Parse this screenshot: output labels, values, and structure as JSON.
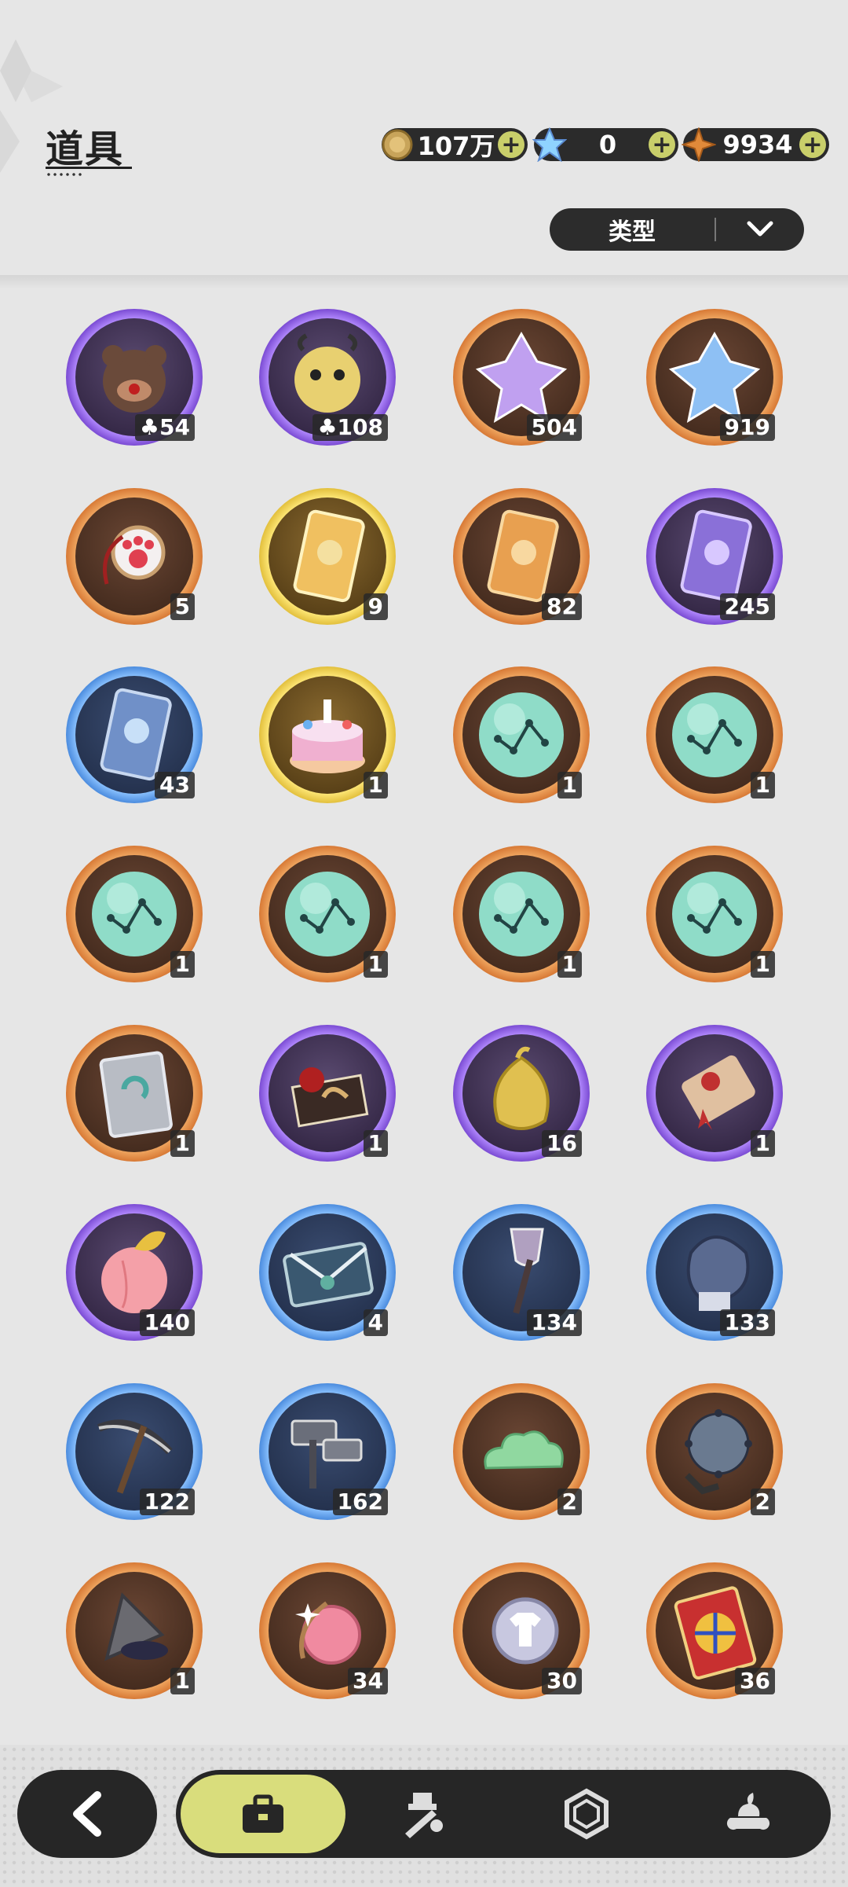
{
  "header": {
    "title": "道具"
  },
  "currencies": [
    {
      "name": "gold-coin",
      "value": "107万",
      "color": "#c8a45a"
    },
    {
      "name": "crystal",
      "value": "0",
      "color": "#8fd3ff"
    },
    {
      "name": "star-gem",
      "value": "9934",
      "color": "#e08a3a"
    }
  ],
  "filter": {
    "label": "类型"
  },
  "items": [
    {
      "icon": "bear-mask-icon",
      "tier": "purple",
      "count": "54",
      "prefix": true
    },
    {
      "icon": "yellow-pet-icon",
      "tier": "purple",
      "count": "108",
      "prefix": true
    },
    {
      "icon": "purple-crystal-icon",
      "tier": "orange",
      "count": "504"
    },
    {
      "icon": "blue-crystal-icon",
      "tier": "orange",
      "count": "919"
    },
    {
      "icon": "paw-charm-icon",
      "tier": "orange",
      "count": "5"
    },
    {
      "icon": "gold-card-icon",
      "tier": "gold",
      "count": "9"
    },
    {
      "icon": "orange-card-icon",
      "tier": "orange",
      "count": "82"
    },
    {
      "icon": "purple-card-icon",
      "tier": "purple",
      "count": "245"
    },
    {
      "icon": "blue-card-icon",
      "tier": "blue",
      "count": "43"
    },
    {
      "icon": "birthday-cake-icon",
      "tier": "gold",
      "count": "1"
    },
    {
      "icon": "constellation-orb-icon",
      "tier": "orange",
      "count": "1"
    },
    {
      "icon": "constellation-orb-icon",
      "tier": "orange",
      "count": "1"
    },
    {
      "icon": "constellation-orb-icon",
      "tier": "orange",
      "count": "1"
    },
    {
      "icon": "constellation-orb-icon",
      "tier": "orange",
      "count": "1"
    },
    {
      "icon": "constellation-orb-icon",
      "tier": "orange",
      "count": "1"
    },
    {
      "icon": "constellation-orb-icon",
      "tier": "orange",
      "count": "1"
    },
    {
      "icon": "rune-tablet-icon",
      "tier": "orange",
      "count": "1"
    },
    {
      "icon": "gift-box-icon",
      "tier": "purple",
      "count": "1"
    },
    {
      "icon": "golden-pouch-icon",
      "tier": "purple",
      "count": "16"
    },
    {
      "icon": "scroll-icon",
      "tier": "purple",
      "count": "1"
    },
    {
      "icon": "peach-icon",
      "tier": "purple",
      "count": "140"
    },
    {
      "icon": "envelope-icon",
      "tier": "blue",
      "count": "4"
    },
    {
      "icon": "shovel-icon",
      "tier": "blue",
      "count": "134"
    },
    {
      "icon": "boxing-glove-icon",
      "tier": "blue",
      "count": "133"
    },
    {
      "icon": "pickaxe-icon",
      "tier": "blue",
      "count": "122"
    },
    {
      "icon": "hammer-icon",
      "tier": "blue",
      "count": "162"
    },
    {
      "icon": "green-cloud-icon",
      "tier": "orange",
      "count": "2"
    },
    {
      "icon": "spiked-ball-icon",
      "tier": "orange",
      "count": "2"
    },
    {
      "icon": "drill-icon",
      "tier": "orange",
      "count": "1"
    },
    {
      "icon": "rose-gem-icon",
      "tier": "orange",
      "count": "34"
    },
    {
      "icon": "shirt-token-icon",
      "tier": "orange",
      "count": "30"
    },
    {
      "icon": "wheel-ticket-icon",
      "tier": "orange",
      "count": "36"
    }
  ],
  "tabs": [
    {
      "name": "bag-icon",
      "active": true
    },
    {
      "name": "forge-icon",
      "active": false
    },
    {
      "name": "hexagon-icon",
      "active": false
    },
    {
      "name": "dessert-icon",
      "active": false
    }
  ]
}
